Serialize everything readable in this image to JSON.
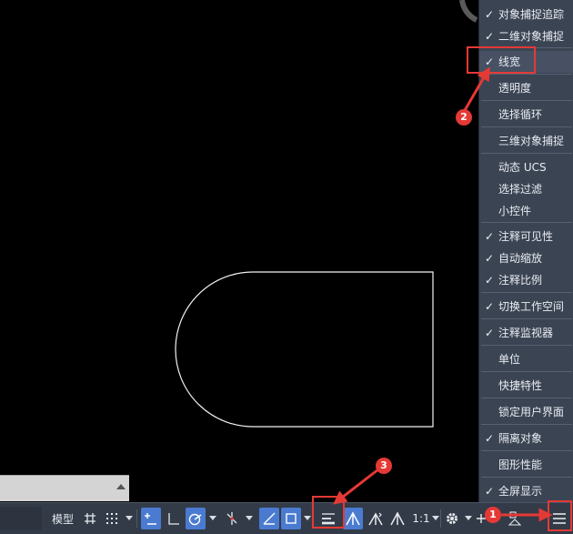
{
  "menu": {
    "items": [
      {
        "label": "对象捕捉追踪",
        "checked": true
      },
      {
        "label": "二维对象捕捉",
        "checked": true
      },
      {
        "label": "线宽",
        "checked": true
      },
      {
        "label": "透明度",
        "checked": false
      },
      {
        "label": "选择循环",
        "checked": false
      },
      {
        "label": "三维对象捕捉",
        "checked": false
      },
      {
        "label": "动态 UCS",
        "checked": false
      },
      {
        "label": "选择过滤",
        "checked": false
      },
      {
        "label": "小控件",
        "checked": false
      },
      {
        "label": "注释可见性",
        "checked": true
      },
      {
        "label": "自动缩放",
        "checked": true
      },
      {
        "label": "注释比例",
        "checked": true
      },
      {
        "label": "切换工作空间",
        "checked": true
      },
      {
        "label": "注释监视器",
        "checked": true
      },
      {
        "label": "单位",
        "checked": false
      },
      {
        "label": "快捷特性",
        "checked": false
      },
      {
        "label": "锁定用户界面",
        "checked": false
      },
      {
        "label": "隔离对象",
        "checked": true
      },
      {
        "label": "图形性能",
        "checked": false
      },
      {
        "label": "全屏显示",
        "checked": true
      }
    ],
    "check_glyph": "✓"
  },
  "statusbar": {
    "model_label": "模型",
    "scale_label": "1:1",
    "icons": [
      "grid-icon",
      "snap-dots-icon",
      "infer-constraint-icon",
      "ortho-icon",
      "polar-icon",
      "isodraft-icon",
      "object-snap-tracking-icon",
      "object-snap-icon",
      "lineweight-icon",
      "annotation-visibility-icon",
      "auto-scale-icon",
      "annotation-scale-icon",
      "gear-icon",
      "plus-icon",
      "isolate-icon",
      "customization-menu-icon"
    ]
  },
  "annotations": {
    "badges": [
      "1",
      "2",
      "3"
    ]
  },
  "colors": {
    "menu_bg": "#3b4453",
    "status_bg": "#333b48",
    "active_blue": "#4a7bd1",
    "annotation_red": "#e53935",
    "canvas_bg": "#000000"
  }
}
